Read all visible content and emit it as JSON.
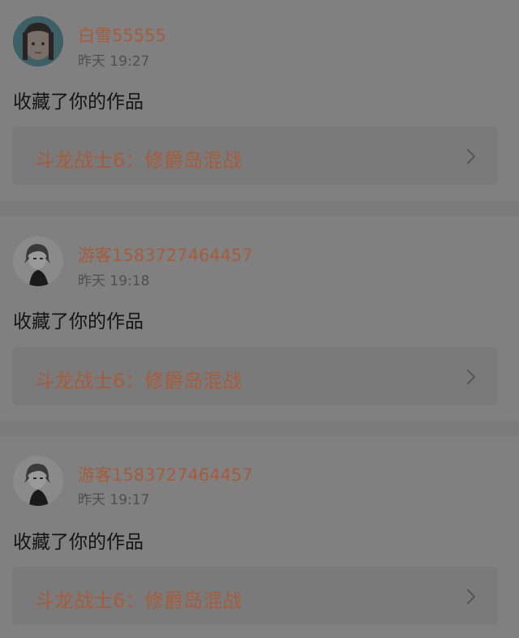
{
  "notifications": [
    {
      "username": "白雪55555",
      "time": "昨天 19:27",
      "action": "收藏了你的作品",
      "work_title": "斗龙战士6：修爵岛混战",
      "avatar_icon": "girl-photo-avatar-icon"
    },
    {
      "username": "游客1583727464457",
      "time": "昨天 19:18",
      "action": "收藏了你的作品",
      "work_title": "斗龙战士6：修爵岛混战",
      "avatar_icon": "anime-character-avatar-icon"
    },
    {
      "username": "游客1583727464457",
      "time": "昨天 19:17",
      "action": "收藏了你的作品",
      "work_title": "斗龙战士6：修爵岛混战",
      "avatar_icon": "anime-character-avatar-icon"
    }
  ],
  "colors": {
    "username": "#a65b3a",
    "work_title": "#a65b3a",
    "card_bg": "#808080",
    "link_bg": "#7a7a7a",
    "divider": "#747474"
  }
}
